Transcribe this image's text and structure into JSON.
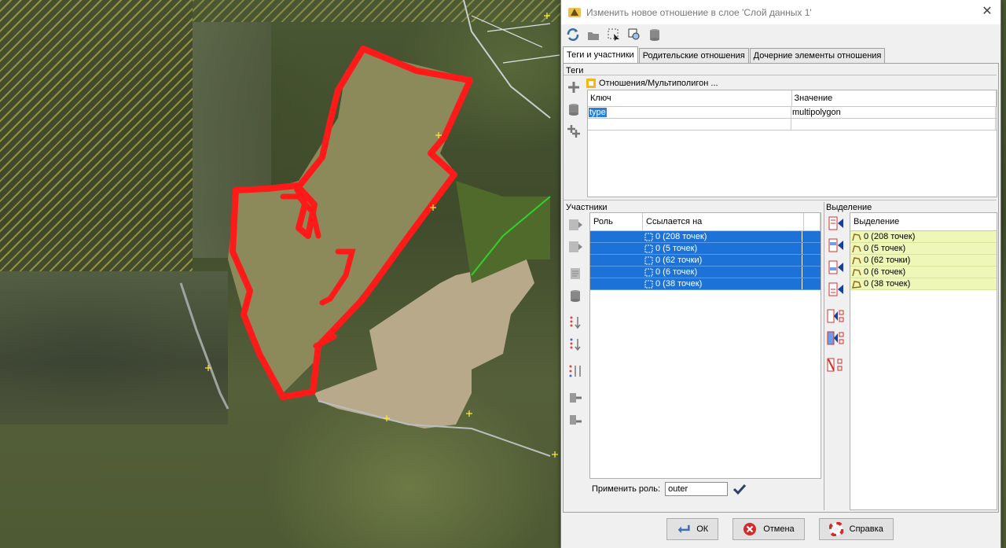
{
  "dialog": {
    "title": "Изменить новое отношение в слое 'Слой данных 1'",
    "close_glyph": "✕",
    "toolbar": [
      {
        "icon": "refresh-icon"
      },
      {
        "icon": "download-members-icon"
      },
      {
        "icon": "select-members-icon"
      },
      {
        "icon": "zoom-to-relation-icon"
      },
      {
        "icon": "delete-relation-icon"
      }
    ],
    "tabs": [
      {
        "label": "Теги и участники",
        "active": true
      },
      {
        "label": "Родительские отношения",
        "active": false
      },
      {
        "label": "Дочерние элементы отношения",
        "active": false
      }
    ],
    "tags": {
      "section_label": "Теги",
      "relation_label": "Отношения/Мультиполигон ...",
      "columns": {
        "key": "Ключ",
        "value": "Значение"
      },
      "rows": [
        {
          "key": "type",
          "value": "multipolygon"
        }
      ]
    },
    "members": {
      "section_label": "Участники",
      "columns": {
        "role": "Роль",
        "ref": "Ссылается на"
      },
      "rows": [
        {
          "role": "",
          "ref": "0 (208 точек)"
        },
        {
          "role": "",
          "ref": "0 (5 точек)"
        },
        {
          "role": "",
          "ref": "0 (62 точки)"
        },
        {
          "role": "",
          "ref": "0 (6 точек)"
        },
        {
          "role": "",
          "ref": "0 (38 точек)"
        }
      ],
      "apply_role_label": "Применить роль:",
      "apply_role_value": "outer"
    },
    "selection": {
      "section_label": "Выделение",
      "column": "Выделение",
      "rows": [
        {
          "label": "0 (208 точек)"
        },
        {
          "label": "0 (5 точек)"
        },
        {
          "label": "0 (62 точки)"
        },
        {
          "label": "0 (6 точек)"
        },
        {
          "label": "0 (38 точек)"
        }
      ]
    },
    "buttons": {
      "ok": "ОК",
      "cancel": "Отмена",
      "help": "Справка"
    }
  },
  "colors": {
    "selection_blue": "#1c72d6",
    "selection_yellow": "#eef7b8",
    "polygon_red": "#ff1a1a"
  }
}
